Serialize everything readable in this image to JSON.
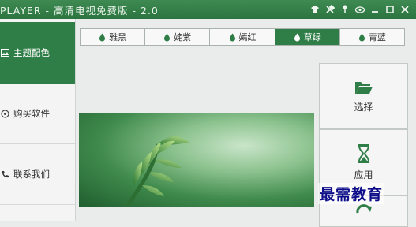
{
  "window": {
    "title": "PLAYER - 高清电视免费版 - 2.0"
  },
  "sidebar": {
    "items": [
      {
        "label": "主题配色",
        "icon": "image-icon",
        "active": true
      },
      {
        "label": "购买软件",
        "icon": "coin-icon",
        "active": false
      },
      {
        "label": "联系我们",
        "icon": "phone-icon",
        "active": false
      }
    ]
  },
  "tabs": [
    {
      "label": "雅黑",
      "active": false
    },
    {
      "label": "姹紫",
      "active": false
    },
    {
      "label": "嫣红",
      "active": false
    },
    {
      "label": "草绿",
      "active": true
    },
    {
      "label": "青蓝",
      "active": false
    }
  ],
  "right_panel": {
    "select_label": "选择",
    "apply_label": "应用"
  },
  "watermark": "最需教育",
  "colors": {
    "accent": "#2f7d47",
    "titlebar": "#2c7440"
  }
}
